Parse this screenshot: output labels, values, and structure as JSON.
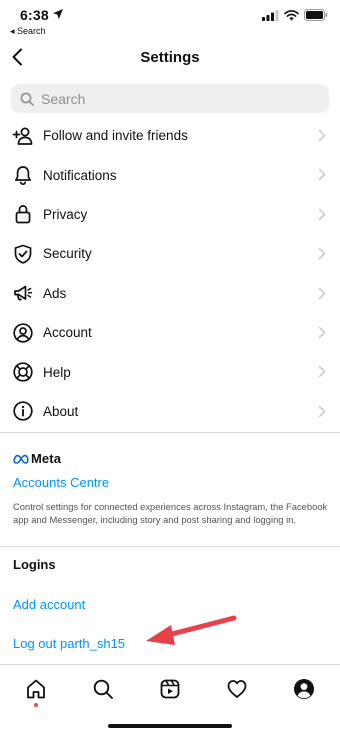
{
  "status_bar": {
    "time": "6:38",
    "back_app": "◂ Search"
  },
  "header": {
    "title": "Settings"
  },
  "search": {
    "placeholder": "Search"
  },
  "menu": {
    "items": [
      {
        "label": "Follow and invite friends",
        "icon": "add-person-icon"
      },
      {
        "label": "Notifications",
        "icon": "bell-icon"
      },
      {
        "label": "Privacy",
        "icon": "lock-icon"
      },
      {
        "label": "Security",
        "icon": "shield-icon"
      },
      {
        "label": "Ads",
        "icon": "megaphone-icon"
      },
      {
        "label": "Account",
        "icon": "person-circle-icon"
      },
      {
        "label": "Help",
        "icon": "lifebuoy-icon"
      },
      {
        "label": "About",
        "icon": "info-icon"
      }
    ]
  },
  "meta": {
    "wordmark": "Meta",
    "accounts_centre": "Accounts Centre",
    "description": "Control settings for connected experiences across Instagram, the Facebook app and Messenger, including story and post sharing and logging in."
  },
  "logins": {
    "heading": "Logins",
    "add_account": "Add account",
    "log_out": "Log out parth_sh15"
  },
  "colors": {
    "link": "#0095f6",
    "annotation_arrow": "#e8414a"
  },
  "tab_bar": {
    "tabs": [
      "home-icon",
      "search-icon",
      "reels-icon",
      "heart-icon",
      "profile-icon"
    ]
  }
}
